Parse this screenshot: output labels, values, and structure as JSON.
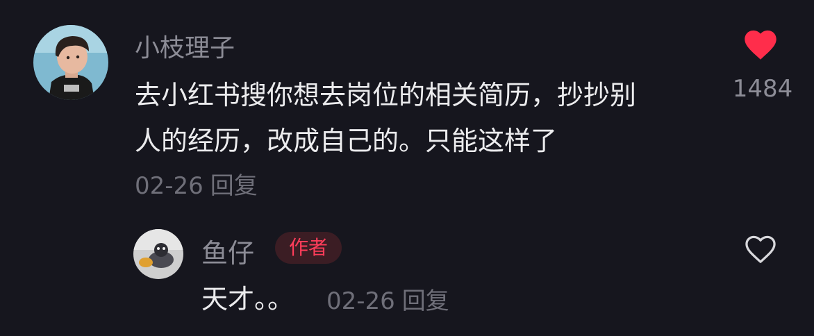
{
  "comment": {
    "username": "小枝理子",
    "text": "去小红书搜你想去岗位的相关简历，抄抄别\n人的经历，改成自己的。只能这样了",
    "date": "02-26",
    "reply_label": "回复",
    "likes": "1484",
    "liked": true,
    "like_color": "#ff2d4b",
    "like_icon": "heart-filled-icon"
  },
  "reply": {
    "username": "鱼仔",
    "badge": "作者",
    "badge_color": "#ff3d5a",
    "text": "天才。。",
    "date": "02-26",
    "reply_label": "回复",
    "liked": false,
    "like_icon": "heart-outline-icon"
  }
}
